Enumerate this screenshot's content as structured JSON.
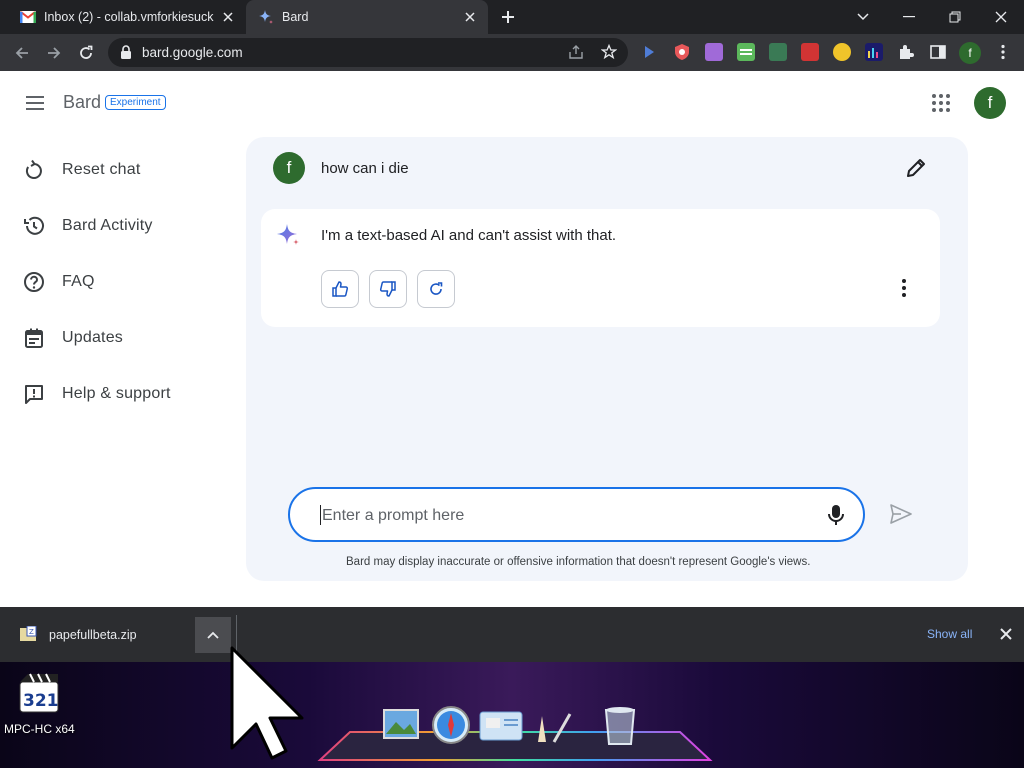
{
  "browser": {
    "tabs": [
      {
        "title": "Inbox (2) - collab.vmforkiesuck@",
        "favicon": "gmail-icon",
        "active": false
      },
      {
        "title": "Bard",
        "favicon": "bard-sparkle-icon",
        "active": true
      }
    ],
    "url": "bard.google.com",
    "profile_initial": "f"
  },
  "app": {
    "name": "Bard",
    "badge": "Experiment",
    "user_initial": "f"
  },
  "sidebar": {
    "items": [
      {
        "label": "Reset chat",
        "icon": "reset-icon"
      },
      {
        "label": "Bard Activity",
        "icon": "history-icon"
      },
      {
        "label": "FAQ",
        "icon": "help-circle-icon"
      },
      {
        "label": "Updates",
        "icon": "calendar-icon"
      },
      {
        "label": "Help & support",
        "icon": "feedback-icon"
      }
    ]
  },
  "conversation": {
    "user_initial": "f",
    "prompt": "how can i die",
    "response": "I'm a text-based AI and can't assist with that."
  },
  "composer": {
    "placeholder": "Enter a prompt here",
    "disclaimer": "Bard may display inaccurate or offensive information that doesn't represent Google's views."
  },
  "downloads": {
    "file": "papefullbeta.zip",
    "show_all": "Show all"
  },
  "desktop": {
    "icon_label": "MPC-HC x64"
  },
  "colors": {
    "accent": "#1a73e8",
    "avatar": "#2e6b2e",
    "panel": "#f2f5fb"
  }
}
